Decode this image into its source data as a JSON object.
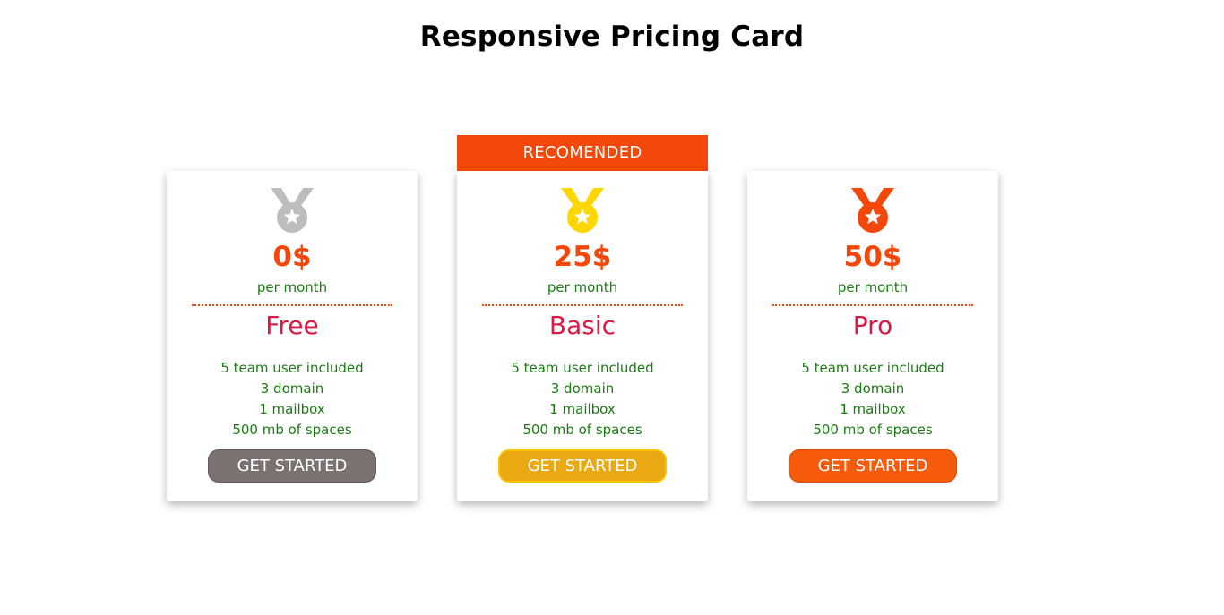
{
  "page": {
    "title": "Responsive Pricing Card"
  },
  "recommended_label": "RECOMENDED",
  "plans": [
    {
      "price": "0$",
      "period": "per month",
      "name": "Free",
      "features": [
        "5 team user included",
        "3 domain",
        "1 mailbox",
        "500 mb of spaces"
      ],
      "button_label": "GET STARTED",
      "medal_icon": "silver-medal-icon",
      "medal_color": "#bdbdbd",
      "button_color": "#7a7271"
    },
    {
      "price": "25$",
      "period": "per month",
      "name": "Basic",
      "features": [
        "5 team user included",
        "3 domain",
        "1 mailbox",
        "500 mb of spaces"
      ],
      "button_label": "GET STARTED",
      "medal_icon": "gold-medal-icon",
      "medal_color": "#ffd600",
      "button_color": "#eaa812"
    },
    {
      "price": "50$",
      "period": "per month",
      "name": "Pro",
      "features": [
        "5 team user included",
        "3 domain",
        "1 mailbox",
        "500 mb of spaces"
      ],
      "button_label": "GET STARTED",
      "medal_icon": "bronze-medal-icon",
      "medal_color": "#f4470a",
      "button_color": "#f65a0b"
    }
  ],
  "colors": {
    "accent": "#f4470a",
    "plan_name": "#d81b44",
    "feature_text": "#1a7d12"
  }
}
